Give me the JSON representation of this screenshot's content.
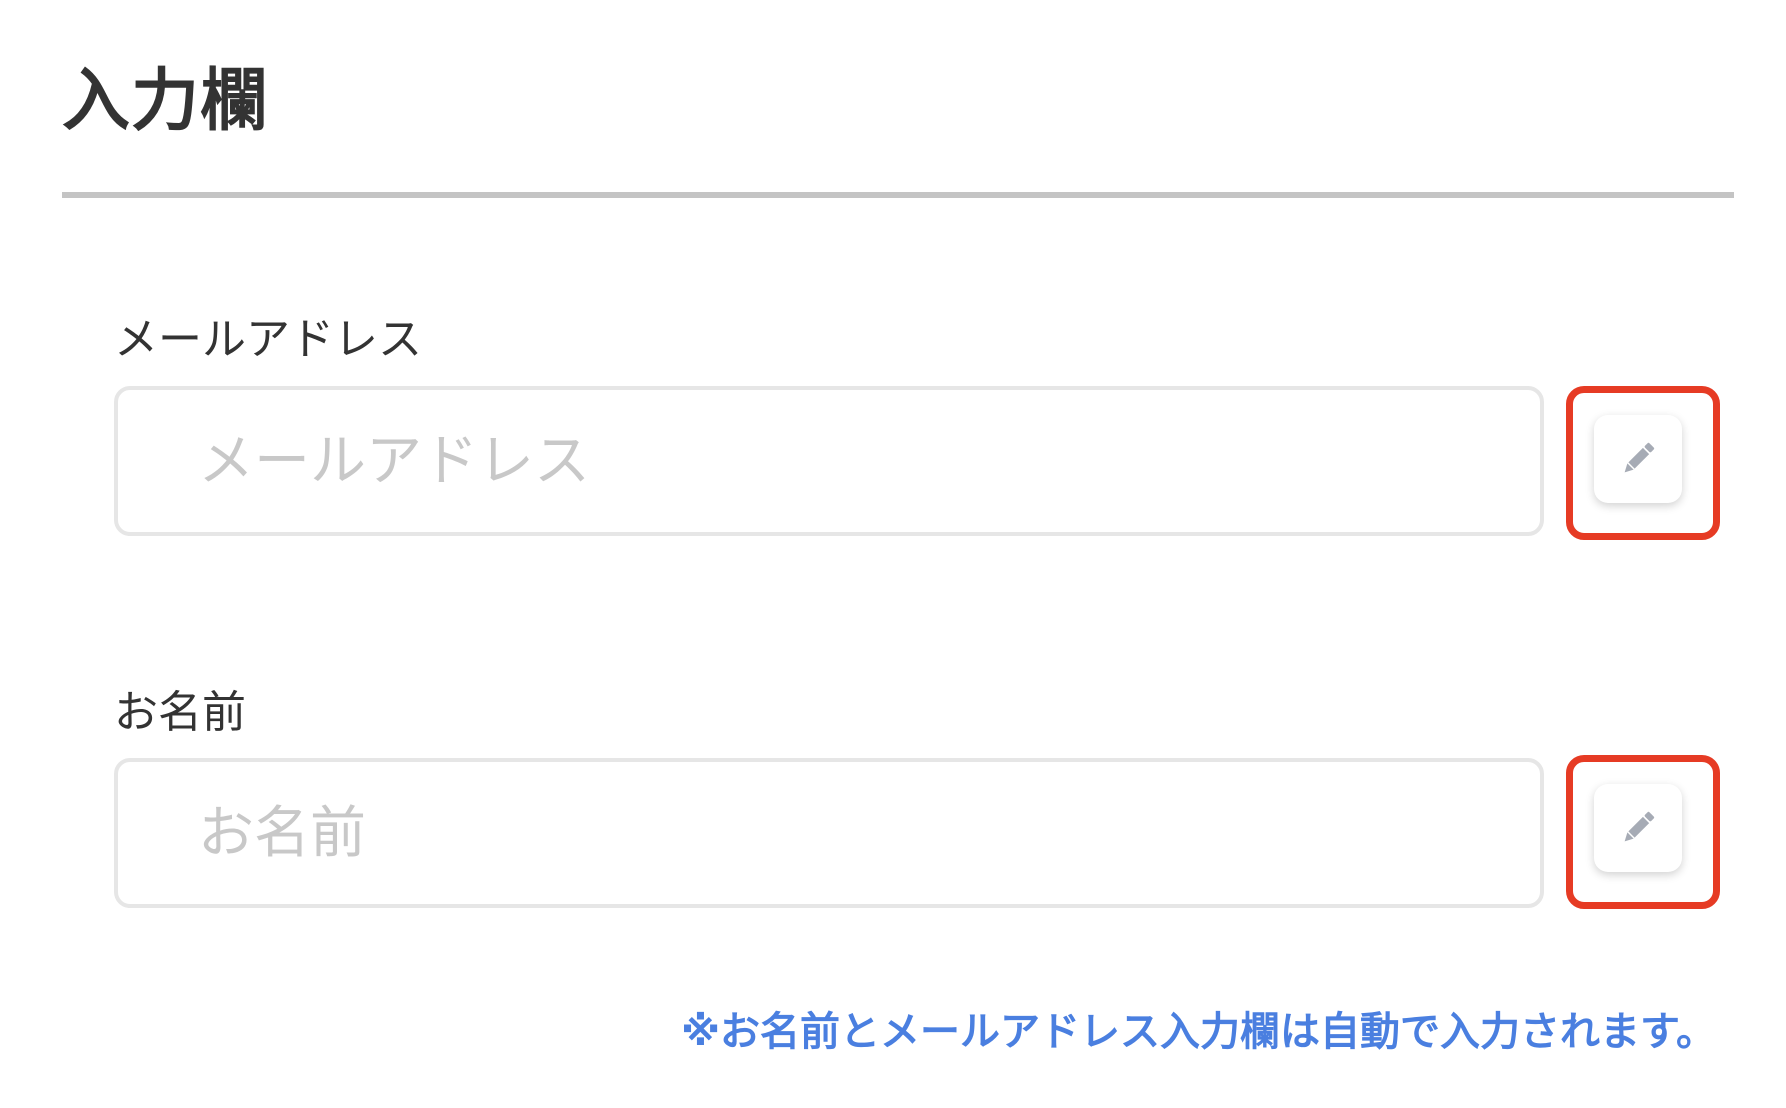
{
  "section": {
    "title": "入力欄"
  },
  "fields": [
    {
      "label": "メールアドレス",
      "placeholder": "メールアドレス",
      "value": ""
    },
    {
      "label": "お名前",
      "placeholder": "お名前",
      "value": ""
    }
  ],
  "edit_button": {
    "icon": "pencil-icon"
  },
  "note": "※お名前とメールアドレス入力欄は自動で入力されます。",
  "colors": {
    "text": "#333333",
    "placeholder": "#c8c8c8",
    "divider": "#c4c4c4",
    "input_border": "#e6e6e6",
    "highlight": "#e63b24",
    "note": "#4a7fe0",
    "icon": "#a6abb5"
  }
}
